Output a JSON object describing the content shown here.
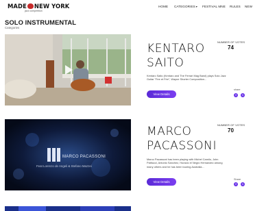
{
  "header": {
    "logo_text_left": "MADE",
    "logo_text_right": "NEW YORK",
    "logo_tagline": "jazz competition",
    "nav": [
      "HOME",
      "CATEGORIES",
      "FESTIVAL MNE",
      "RULES",
      "NEW"
    ]
  },
  "page": {
    "title": "SOLO INSTRUMENTAL",
    "breadcrumb": "Categories"
  },
  "cards": [
    {
      "name_line1": "KENTARO",
      "name_line2": "SAITO",
      "votes_label": "NUMBER OF VOTES",
      "votes": "74",
      "description": "Kentaro Saito (Kentaro and The Ferrari Mag Band) plays Solo Jazz Guitar \"Fee et Fée\", Wayne Shorter Composition...",
      "button": "View Details",
      "share_label": "share",
      "share_icons": [
        "facebook-icon",
        "twitter-icon"
      ]
    },
    {
      "name_line1": "MARCO",
      "name_line2": "PACASSONI",
      "votes_label": "NUMBER OF VOTES",
      "votes": "70",
      "description": "Marco Pacassoni has been playing with Michel Camilo, John Patitucci, Antonio Sanchez, Horacio el Negro Hernandez among many others and he has been touring Australia...",
      "button": "View Details",
      "share_label": "Share",
      "share_icons": [
        "facebook-icon",
        "twitter-icon"
      ],
      "thumb_logo": "MARCO PACASSONI",
      "thumb_caption": "Feat Lorenzo de Angeli & Stefano Mazzei"
    }
  ],
  "colors": {
    "accent": "#6a34e8",
    "brand_red": "#c62a2a"
  }
}
